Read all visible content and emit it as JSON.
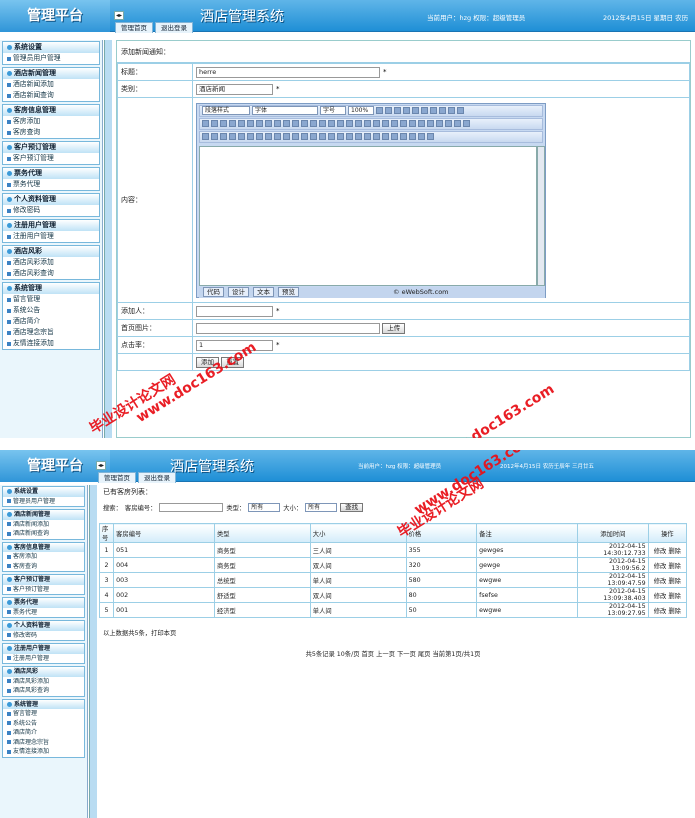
{
  "app": {
    "logo": "管理平台",
    "title": "酒店管理系统",
    "user_info": "当前用户：hzg  权限：超级管理员",
    "date_info_1": "2012年4月15日  星期日  农历",
    "date_info_2": "2012年4月15日  农历壬辰年  三月廿五",
    "collapse_icon": "◂▸",
    "tabs": [
      "管理首页",
      "退出登录"
    ]
  },
  "sidebar": [
    {
      "title": "系统设置",
      "items": [
        "管理员用户管理"
      ]
    },
    {
      "title": "酒店新闻管理",
      "items": [
        "酒店新闻添加",
        "酒店新闻查询"
      ]
    },
    {
      "title": "客房信息管理",
      "items": [
        "客房添加",
        "客房查询"
      ]
    },
    {
      "title": "客户预订管理",
      "items": [
        "客户预订管理"
      ]
    },
    {
      "title": "票务代理",
      "items": [
        "票务代理"
      ]
    },
    {
      "title": "个人资料管理",
      "items": [
        "修改密码"
      ]
    },
    {
      "title": "注册用户管理",
      "items": [
        "注册用户管理"
      ]
    },
    {
      "title": "酒店风彩",
      "items": [
        "酒店风彩添加",
        "酒店风彩查询"
      ]
    },
    {
      "title": "系统管理",
      "items": [
        "留言管理",
        "系统公告",
        "酒店简介",
        "酒店理念宗旨",
        "友情连接添加"
      ]
    }
  ],
  "form": {
    "heading": "添加新闻通知：",
    "title_label": "标题：",
    "title_value": "herre",
    "category_label": "类别：",
    "category_value": "酒店新闻",
    "content_label": "内容：",
    "editor": {
      "para_style": "段落样式",
      "font": "字体",
      "size": "字号",
      "zoom": "100%",
      "modes": [
        "代码",
        "设计",
        "文本",
        "预览"
      ],
      "brand": "© eWebSoft.com"
    },
    "adder_label": "添加人：",
    "image_label": "首页图片：",
    "upload_button": "上传",
    "clicks_label": "点击率：",
    "clicks_value": "1",
    "submit_button": "添加",
    "reset_button": "重置",
    "required_mark": "*"
  },
  "list": {
    "heading": "已有客房列表：",
    "search_label": "搜索：",
    "room_no_label": "客房编号：",
    "type_label": "类型：",
    "type_value": "所有",
    "size_label": "大小：",
    "size_value": "所有",
    "search_button": "查找",
    "columns": [
      "序号",
      "客房编号",
      "类型",
      "大小",
      "价格",
      "备注",
      "添加时间",
      "操作"
    ],
    "rows": [
      [
        "1",
        "051",
        "商务型",
        "三人间",
        "355",
        "gewges",
        "2012-04-15 14:30:12.733",
        "修改",
        "删除"
      ],
      [
        "2",
        "004",
        "商务型",
        "双人间",
        "320",
        "gewge",
        "2012-04-15 13:09:56.2",
        "修改",
        "删除"
      ],
      [
        "3",
        "003",
        "总统型",
        "单人间",
        "580",
        "ewgwe",
        "2012-04-15 13:09:47.59",
        "修改",
        "删除"
      ],
      [
        "4",
        "002",
        "舒适型",
        "双人间",
        "80",
        "fsefse",
        "2012-04-15 13:09:38.403",
        "修改",
        "删除"
      ],
      [
        "5",
        "001",
        "经济型",
        "单人间",
        "50",
        "ewgwe",
        "2012-04-15 13:09:27.95",
        "修改",
        "删除"
      ]
    ],
    "summary": "以上数据共5条，打印本页",
    "pagination": "共5条记录  10条/页  首页  上一页  下一页  尾页  当前第1页/共1页"
  },
  "watermark": {
    "cn": "毕业设计论文网",
    "url": "www.doc163.com"
  },
  "colors": {
    "header": "#1f8fd6",
    "accent": "#3b9ad8",
    "watermark": "#e8121a"
  }
}
